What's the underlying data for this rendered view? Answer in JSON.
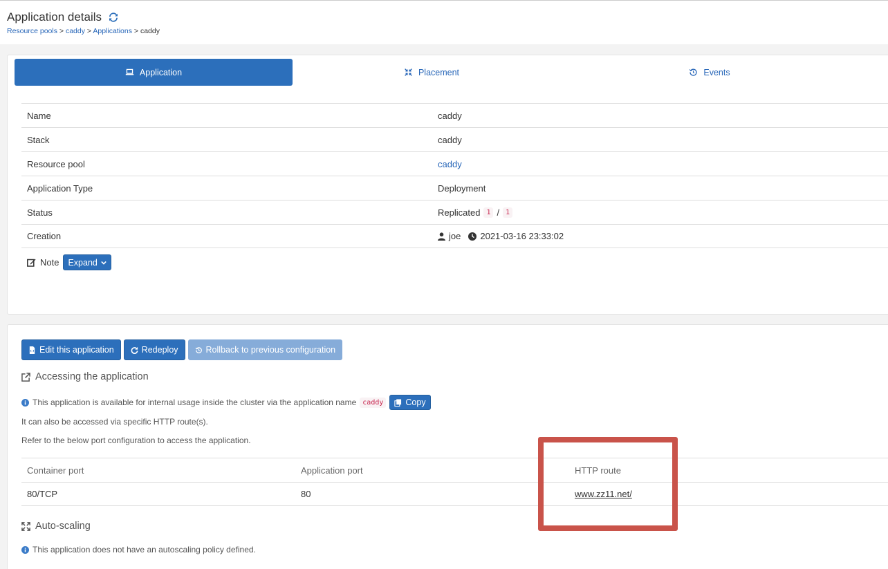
{
  "header": {
    "title": "Application details",
    "breadcrumb": {
      "resource_pools": "Resource pools",
      "sep1": " > ",
      "pool": "caddy",
      "sep2": " > ",
      "applications": "Applications",
      "sep3": " > ",
      "current": "caddy"
    }
  },
  "tabs": [
    {
      "label": "Application",
      "icon": "laptop-icon",
      "active": true
    },
    {
      "label": "Placement",
      "icon": "compress-icon",
      "active": false
    },
    {
      "label": "Events",
      "icon": "history-icon",
      "active": false
    }
  ],
  "details": {
    "name_label": "Name",
    "name_value": "caddy",
    "stack_label": "Stack",
    "stack_value": "caddy",
    "pool_label": "Resource pool",
    "pool_value": "caddy",
    "type_label": "Application Type",
    "type_value": "Deployment",
    "status_label": "Status",
    "status_value": "Replicated",
    "status_running": "1",
    "status_sep": "/",
    "status_total": "1",
    "creation_label": "Creation",
    "creation_user": "joe",
    "creation_date": "2021-03-16 23:33:02",
    "note_label": "Note",
    "expand_label": "Expand"
  },
  "actions": {
    "edit": "Edit this application",
    "redeploy": "Redeploy",
    "rollback": "Rollback to previous configuration"
  },
  "accessing": {
    "title": "Accessing the application",
    "internal_text": "This application is available for internal usage inside the cluster via the application name",
    "app_name_code": "caddy",
    "copy_label": "Copy",
    "http_text": "It can also be accessed via specific HTTP route(s).",
    "refer_text": "Refer to the below port configuration to access the application.",
    "columns": [
      "Container port",
      "Application port",
      "HTTP route"
    ],
    "rows": [
      {
        "container_port": "80/TCP",
        "application_port": "80",
        "http_route": "www.zz11.net/"
      }
    ]
  },
  "autoscaling": {
    "title": "Auto-scaling",
    "text": "This application does not have an autoscaling policy defined."
  },
  "colors": {
    "primary": "#2c6fbb",
    "highlight": "#c9534a"
  }
}
